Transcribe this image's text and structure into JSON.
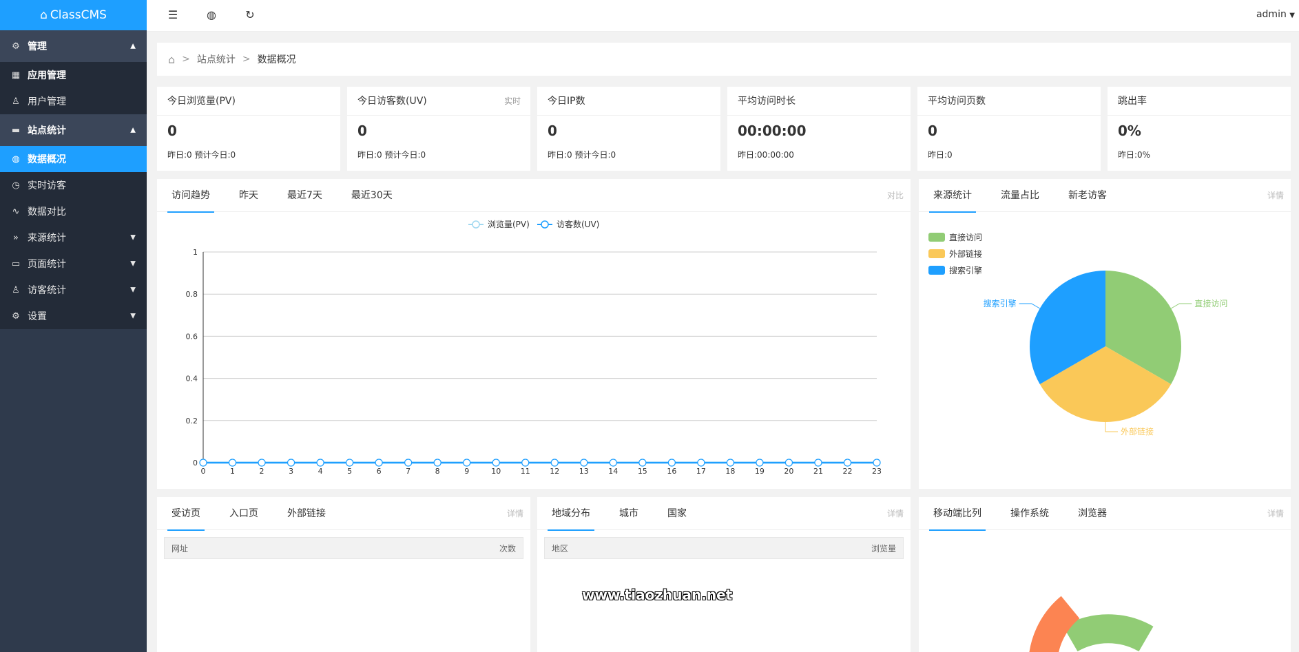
{
  "app": {
    "title": "ClassCMS"
  },
  "sidebar": {
    "group_manage": "管理",
    "manage_items": [
      "应用管理",
      "用户管理"
    ],
    "group_stats": "站点统计",
    "stats_items": [
      "数据概况",
      "实时访客",
      "数据对比",
      "来源统计",
      "页面统计",
      "访客统计",
      "设置"
    ]
  },
  "topbar": {
    "user": "admin"
  },
  "breadcrumb": {
    "level1": "站点统计",
    "level2": "数据概况",
    "sep": ">"
  },
  "stats": [
    {
      "title": "今日浏览量(PV)",
      "note": "",
      "value": "0",
      "sub": "昨日:0 预计今日:0"
    },
    {
      "title": "今日访客数(UV)",
      "note": "实时",
      "value": "0",
      "sub": "昨日:0 预计今日:0"
    },
    {
      "title": "今日IP数",
      "note": "",
      "value": "0",
      "sub": "昨日:0 预计今日:0"
    },
    {
      "title": "平均访问时长",
      "note": "",
      "value": "00:00:00",
      "sub": "昨日:00:00:00"
    },
    {
      "title": "平均访问页数",
      "note": "",
      "value": "0",
      "sub": "昨日:0"
    },
    {
      "title": "跳出率",
      "note": "",
      "value": "0%",
      "sub": "昨日:0%"
    }
  ],
  "trend": {
    "tabs": [
      "访问趋势",
      "昨天",
      "最近7天",
      "最近30天"
    ],
    "right": "对比"
  },
  "source": {
    "tabs": [
      "来源统计",
      "流量占比",
      "新老访客"
    ],
    "right": "详情"
  },
  "pages_panel": {
    "tabs": [
      "受访页",
      "入口页",
      "外部链接"
    ],
    "right": "详情",
    "col1": "网址",
    "col2": "次数"
  },
  "region_panel": {
    "tabs": [
      "地域分布",
      "城市",
      "国家"
    ],
    "right": "详情",
    "col1": "地区",
    "col2": "浏览量"
  },
  "device_panel": {
    "tabs": [
      "移动端比列",
      "操作系统",
      "浏览器"
    ],
    "right": "详情"
  },
  "watermark": "www.tiaozhuan.net",
  "colors": {
    "accent": "#1e9fff",
    "green": "#91cc75",
    "yellow": "#fac858",
    "blue": "#1e9fff",
    "orange": "#fc8452",
    "pv_line": "#a0d8f0",
    "uv_line": "#1e9fff"
  },
  "chart_data": [
    {
      "type": "line",
      "x": [
        0,
        1,
        2,
        3,
        4,
        5,
        6,
        7,
        8,
        9,
        10,
        11,
        12,
        13,
        14,
        15,
        16,
        17,
        18,
        19,
        20,
        21,
        22,
        23
      ],
      "series": [
        {
          "name": "浏览量(PV)",
          "values": [
            0,
            0,
            0,
            0,
            0,
            0,
            0,
            0,
            0,
            0,
            0,
            0,
            0,
            0,
            0,
            0,
            0,
            0,
            0,
            0,
            0,
            0,
            0,
            0
          ]
        },
        {
          "name": "访客数(UV)",
          "values": [
            0,
            0,
            0,
            0,
            0,
            0,
            0,
            0,
            0,
            0,
            0,
            0,
            0,
            0,
            0,
            0,
            0,
            0,
            0,
            0,
            0,
            0,
            0,
            0
          ]
        }
      ],
      "ylim": [
        0,
        1
      ],
      "yticks": [
        "0",
        "0.2",
        "0.4",
        "0.6",
        "0.8",
        "1"
      ],
      "grid": true,
      "legend": "top-center"
    },
    {
      "type": "pie",
      "categories": [
        "直接访问",
        "外部链接",
        "搜索引擎"
      ],
      "values": [
        1,
        1,
        1
      ],
      "legend": "top-left"
    }
  ]
}
